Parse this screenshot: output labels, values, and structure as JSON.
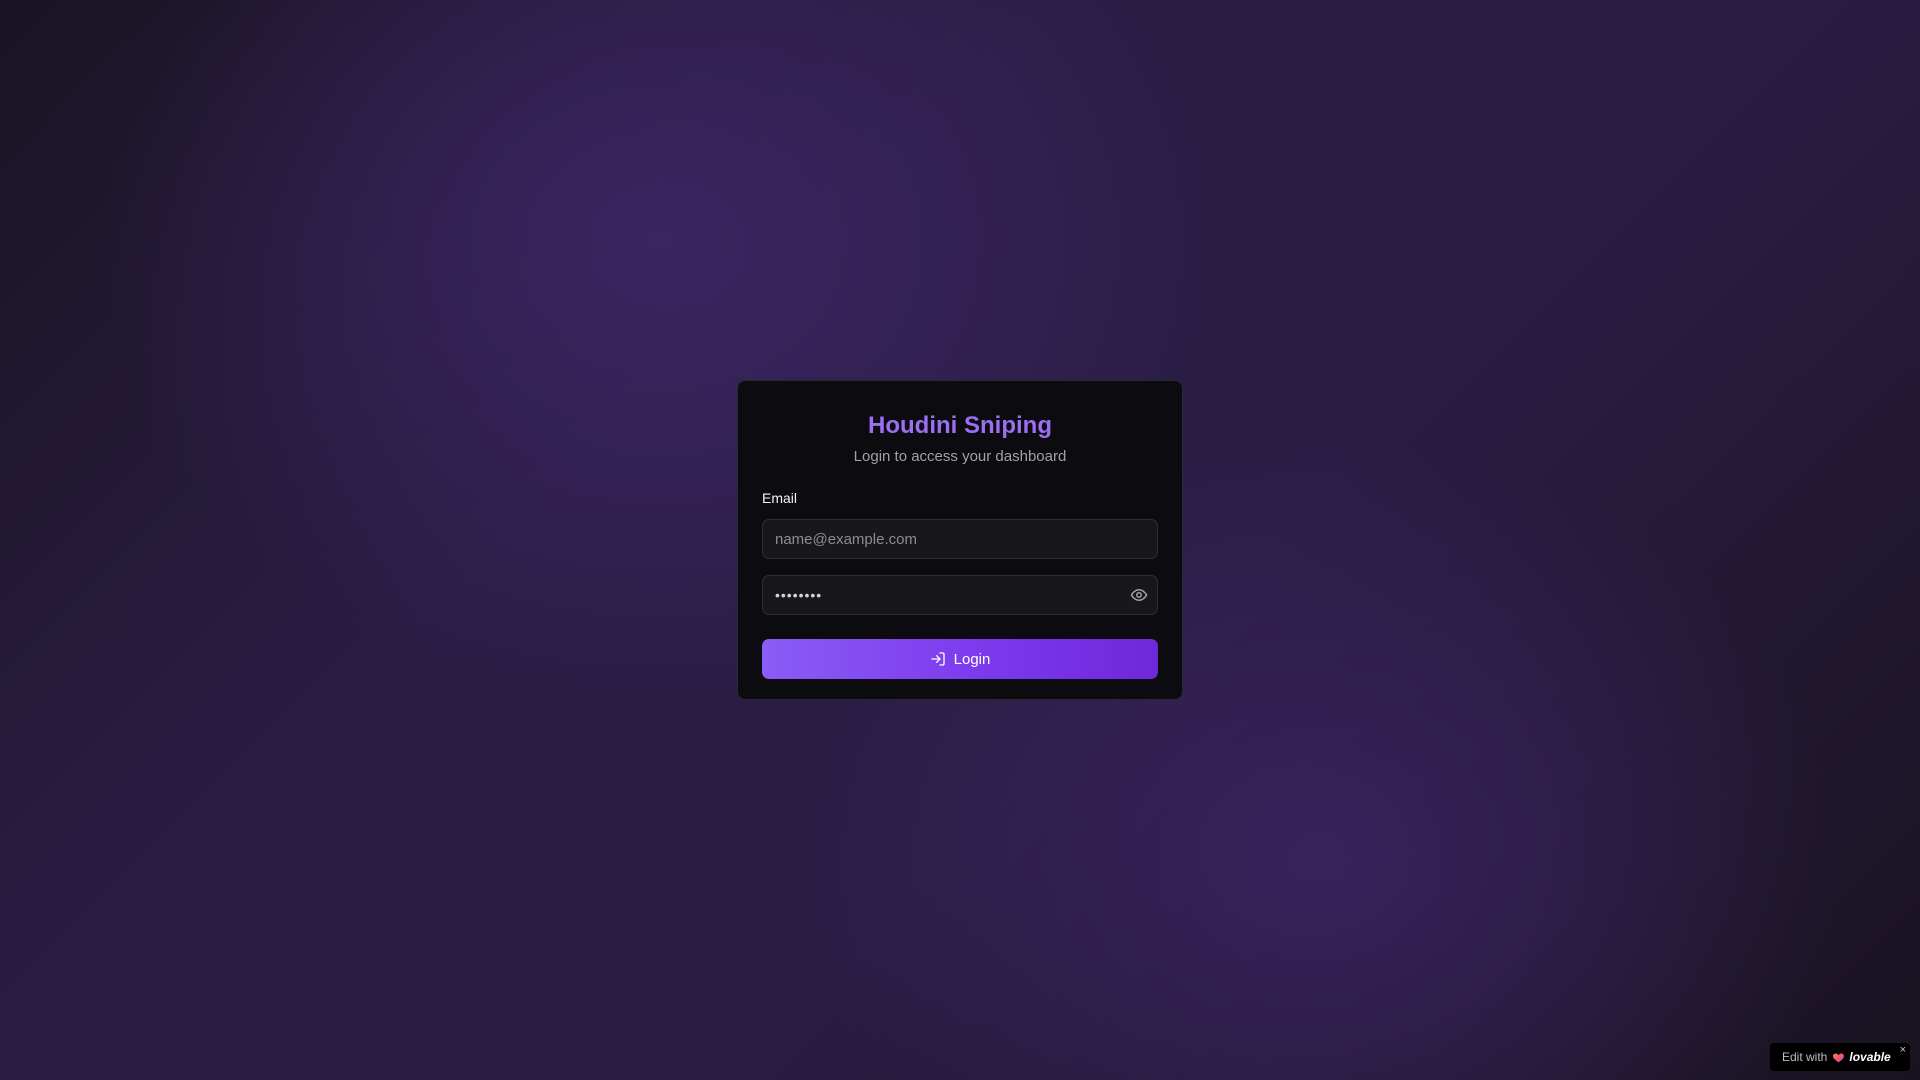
{
  "login_card": {
    "title": "Houdini Sniping",
    "subtitle": "Login to access your dashboard",
    "email_label": "Email",
    "email_placeholder": "name@example.com",
    "password_value": "••••••••",
    "login_label": "Login",
    "title_color": "#9b6ef3",
    "button_color": "#7c3aed"
  },
  "icons": {
    "password_toggle": "eye-icon",
    "login": "log-in-icon"
  },
  "badge": {
    "prefix": "Edit with",
    "brand": "lovable",
    "close": "×"
  }
}
